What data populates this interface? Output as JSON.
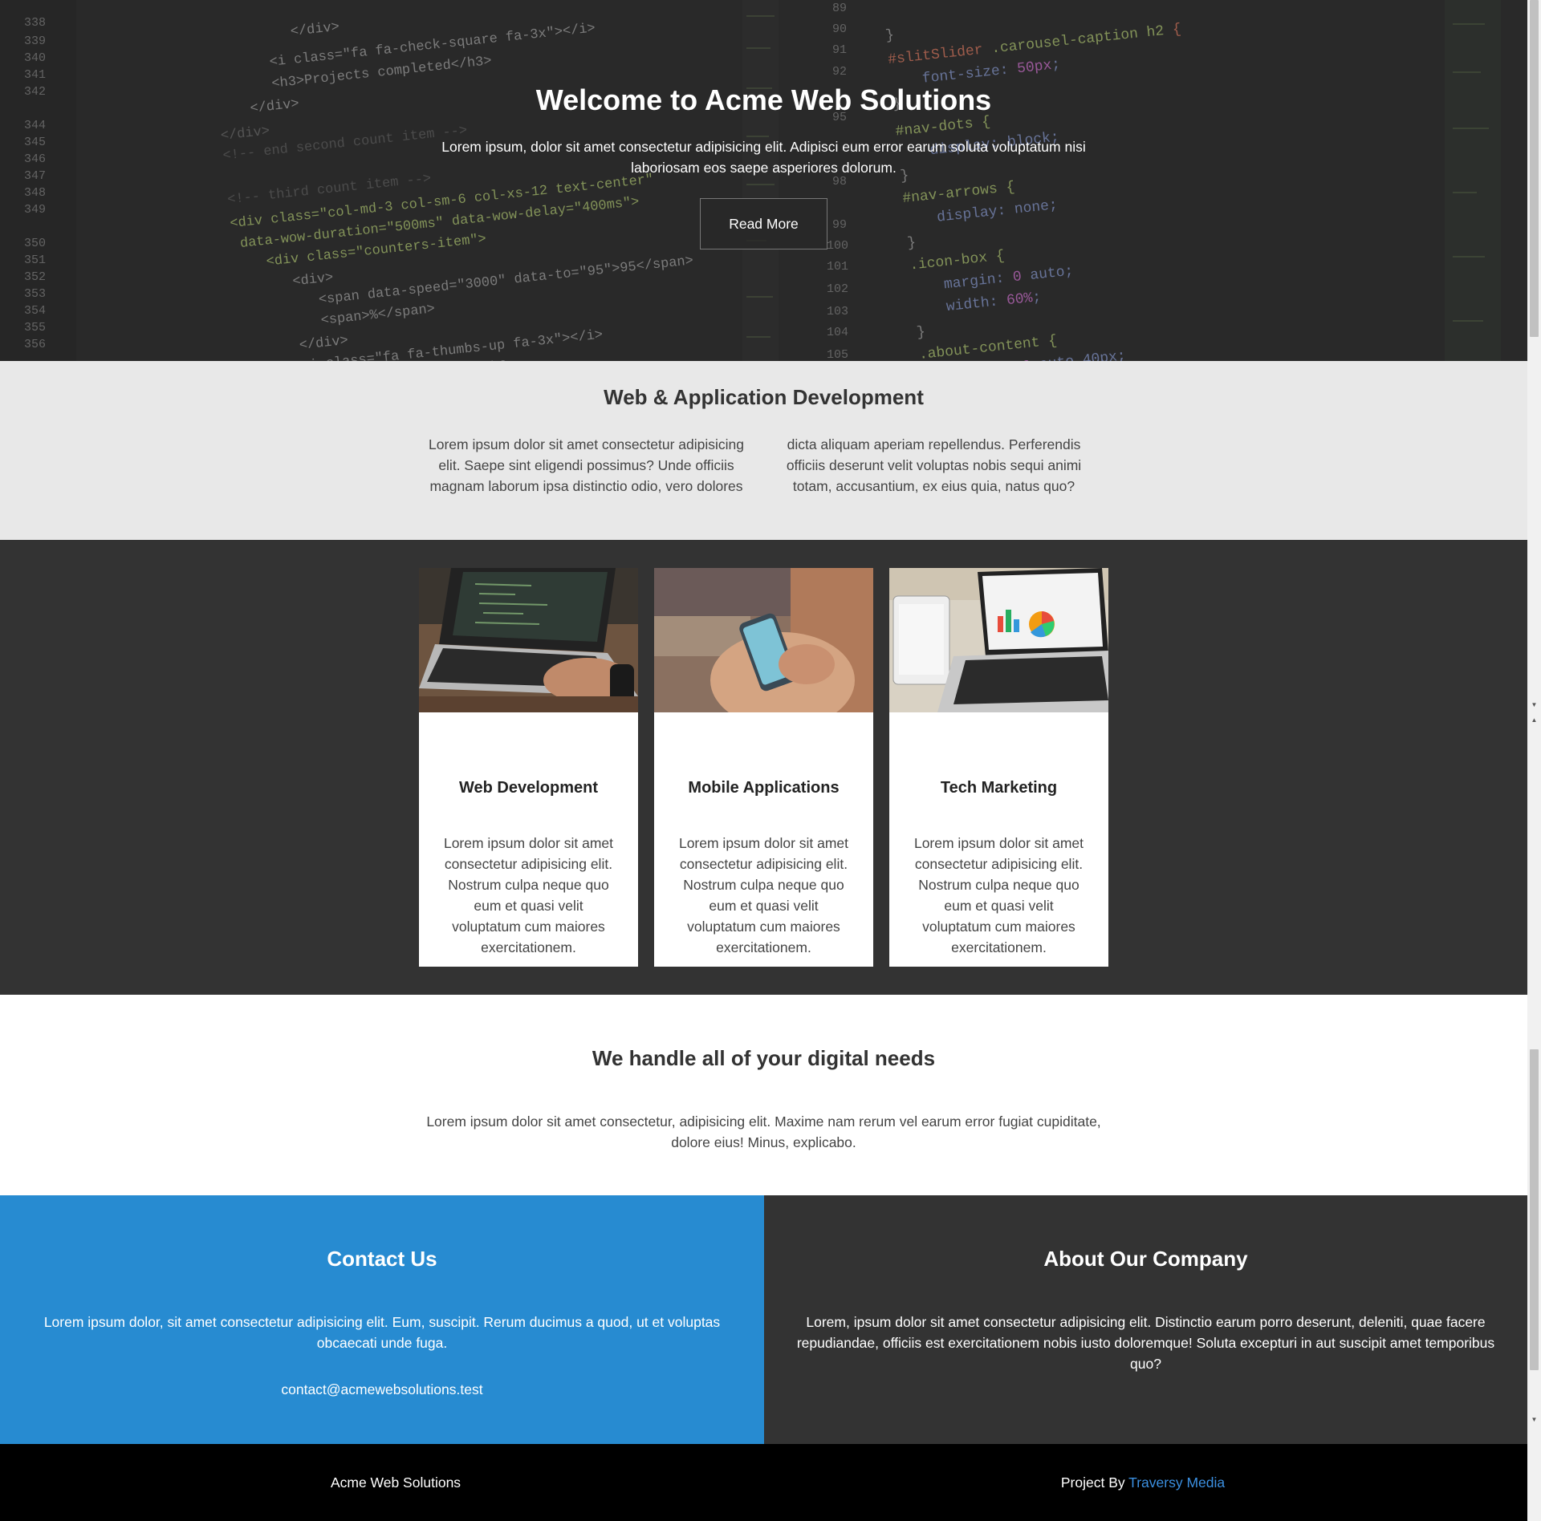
{
  "hero": {
    "title": "Welcome to Acme Web Solutions",
    "text": "Lorem ipsum, dolor sit amet consectetur adipisicing elit. Adipisci eum error earum soluta voluptatum nisi laboriosam eos saepe asperiores dolorum.",
    "button_label": "Read More"
  },
  "intro": {
    "title": "Web & Application Development",
    "text": "Lorem ipsum dolor sit amet consectetur adipisicing elit. Saepe sint eligendi possimus? Unde officiis magnam laborum ipsa distinctio odio, vero dolores dicta aliquam aperiam repellendus. Perferendis officiis deserunt velit voluptas nobis sequi animi totam, accusantium, ex eius quia, natus quo?"
  },
  "services": [
    {
      "title": "Web Development",
      "text": "Lorem ipsum dolor sit amet consectetur adipisicing elit. Nostrum culpa neque quo eum et quasi velit voluptatum cum maiores exercitationem.",
      "image": "laptop-coding-photo"
    },
    {
      "title": "Mobile Applications",
      "text": "Lorem ipsum dolor sit amet consectetur adipisicing elit. Nostrum culpa neque quo eum et quasi velit voluptatum cum maiores exercitationem.",
      "image": "smartphone-hands-photo"
    },
    {
      "title": "Tech Marketing",
      "text": "Lorem ipsum dolor sit amet consectetur adipisicing elit. Nostrum culpa neque quo eum et quasi velit voluptatum cum maiores exercitationem.",
      "image": "laptop-charts-photo"
    }
  ],
  "digital": {
    "title": "We handle all of your digital needs",
    "text": "Lorem ipsum dolor sit amet consectetur, adipisicing elit. Maxime nam rerum vel earum error fugiat cupiditate, dolore eius! Minus, explicabo."
  },
  "contact": {
    "title": "Contact Us",
    "text": "Lorem ipsum dolor, sit amet consectetur adipisicing elit. Eum, suscipit. Rerum ducimus a quod, ut et voluptas obcaecati unde fuga.",
    "email": "contact@acmewebsolutions.test"
  },
  "about": {
    "title": "About Our Company",
    "text": "Lorem, ipsum dolor sit amet consectetur adipisicing elit. Distinctio earum porro deserunt, deleniti, quae facere repudiandae, officiis est exercitationem nobis iusto doloremque! Soluta excepturi in aut suscipit amet temporibus quo?"
  },
  "footer": {
    "brand": "Acme Web Solutions",
    "project_by": "Project By",
    "link_label": "Traversy Media"
  },
  "colors": {
    "hero_bg": "#2e2e2e",
    "intro_bg": "#e8e8e8",
    "dark_bg": "#333333",
    "contact_bg": "#278bd1",
    "footer_bg": "#000000",
    "link": "#3b8fe0"
  }
}
